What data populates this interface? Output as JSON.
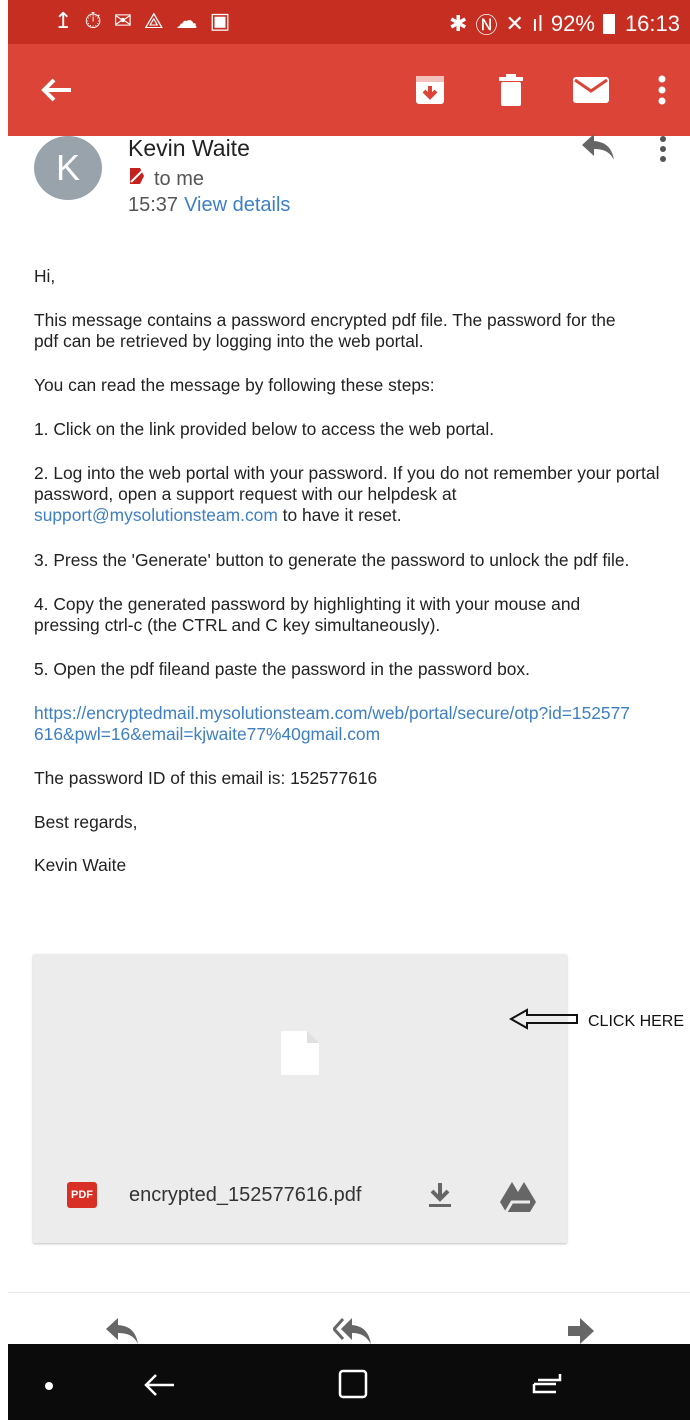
{
  "status_bar": {
    "battery": "92%",
    "time": "16:13"
  },
  "toolbar": {
    "back": "back-arrow-icon",
    "archive": "archive-icon",
    "delete": "trash-icon",
    "mark_unread": "mail-icon",
    "more": "more-vert-icon"
  },
  "email": {
    "avatar_letter": "K",
    "sender": "Kevin Waite",
    "recipient": "to me",
    "time": "15:37",
    "view_details": "View details",
    "greeting": "Hi,",
    "p1": "This message contains a password encrypted pdf file. The password for the pdf can be retrieved by logging into the web portal.",
    "p2": "You can read the message by following these steps:",
    "step1": "1. Click on the link provided below to access the web portal.",
    "step2_a": "2. Log into the web portal with your password. If you do not remember your portal password, open a support request with our helpdesk at",
    "step2_link": "support@mysolutionsteam.com",
    "step2_b": "to have it reset.",
    "step3": "3. Press the 'Generate' button to generate the password to unlock the pdf file.",
    "step4": "4. Copy the generated password by highlighting it with your mouse and pressing ctrl-c (the CTRL and C key simultaneously).",
    "step5": "5. Open the pdf fileand paste the password in the password box.",
    "url": "https://encryptedmail.mysolutionsteam.com/web/portal/secure/otp?id=152577616&pwl=16&email=kjwaite77%40gmail.com",
    "password_id": "The password ID of this email is: 152577616",
    "closing": "Best regards,",
    "signature": "Kevin Waite"
  },
  "attachment": {
    "badge": "PDF",
    "filename": "encrypted_152577616.pdf"
  },
  "annotation": {
    "click_here": "CLICK HERE"
  }
}
